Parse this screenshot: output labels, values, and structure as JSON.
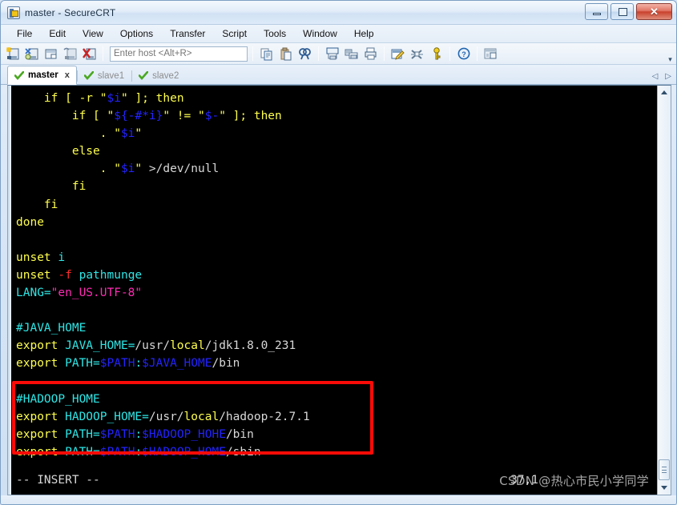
{
  "window": {
    "title": "master - SecureCRT",
    "app_icon": "securecrt-icon",
    "minimize_label": "",
    "maximize_label": "",
    "close_label": "✕"
  },
  "menubar": {
    "items": [
      {
        "label": "File"
      },
      {
        "label": "Edit"
      },
      {
        "label": "View"
      },
      {
        "label": "Options"
      },
      {
        "label": "Transfer"
      },
      {
        "label": "Script"
      },
      {
        "label": "Tools"
      },
      {
        "label": "Window"
      },
      {
        "label": "Help"
      }
    ]
  },
  "toolbar": {
    "host_placeholder": "Enter host <Alt+R>",
    "host_value": "",
    "overflow_label": "▾",
    "icons": [
      {
        "name": "new-session-icon"
      },
      {
        "name": "connect-sftp-icon"
      },
      {
        "name": "clone-session-icon"
      },
      {
        "name": "reconnect-icon"
      },
      {
        "name": "disconnect-icon"
      },
      {
        "name": "copy-icon"
      },
      {
        "name": "paste-icon"
      },
      {
        "name": "find-icon"
      },
      {
        "name": "print-screen-icon"
      },
      {
        "name": "log-session-icon"
      },
      {
        "name": "print-icon"
      },
      {
        "name": "session-options-icon"
      },
      {
        "name": "global-options-icon"
      },
      {
        "name": "key-icon"
      },
      {
        "name": "help-icon"
      },
      {
        "name": "arrange-windows-icon"
      }
    ]
  },
  "tabs": {
    "items": [
      {
        "label": "master",
        "active": true,
        "close_label": "x",
        "status_icon": "check-icon"
      },
      {
        "label": "slave1",
        "active": false,
        "close_label": "",
        "status_icon": "check-icon"
      },
      {
        "label": "slave2",
        "active": false,
        "close_label": "",
        "status_icon": "check-icon"
      }
    ],
    "nav_prev": "◁",
    "nav_next": "▷"
  },
  "terminal": {
    "lines": [
      [
        {
          "t": "    if [ ",
          "c": "kw"
        },
        {
          "t": "-r",
          "c": "kw"
        },
        {
          "t": " \"",
          "c": "kw"
        },
        {
          "t": "$i",
          "c": "var"
        },
        {
          "t": "\" ]; then",
          "c": "kw"
        }
      ],
      [
        {
          "t": "        if [ \"",
          "c": "kw"
        },
        {
          "t": "${-#*i}",
          "c": "var"
        },
        {
          "t": "\" != \"",
          "c": "kw"
        },
        {
          "t": "$-",
          "c": "var"
        },
        {
          "t": "\" ]; then",
          "c": "kw"
        }
      ],
      [
        {
          "t": "            . \"",
          "c": "kw"
        },
        {
          "t": "$i",
          "c": "var"
        },
        {
          "t": "\"",
          "c": "kw"
        }
      ],
      [
        {
          "t": "        else",
          "c": "kw"
        }
      ],
      [
        {
          "t": "            . \"",
          "c": "kw"
        },
        {
          "t": "$i",
          "c": "var"
        },
        {
          "t": "\" ",
          "c": "kw"
        },
        {
          "t": ">/dev/null",
          "c": "white"
        }
      ],
      [
        {
          "t": "        fi",
          "c": "kw"
        }
      ],
      [
        {
          "t": "    fi",
          "c": "kw"
        }
      ],
      [
        {
          "t": "done",
          "c": "kw"
        }
      ],
      [
        {
          "t": "",
          "c": "white"
        }
      ],
      [
        {
          "t": "unset",
          "c": "kw"
        },
        {
          "t": " i",
          "c": "cyan"
        }
      ],
      [
        {
          "t": "unset",
          "c": "kw"
        },
        {
          "t": " ",
          "c": "white"
        },
        {
          "t": "-f",
          "c": "red"
        },
        {
          "t": " pathmunge",
          "c": "cyan"
        }
      ],
      [
        {
          "t": "LANG=",
          "c": "cyan"
        },
        {
          "t": "\"en_US.UTF-8\"",
          "c": "str"
        }
      ],
      [
        {
          "t": "",
          "c": "white"
        }
      ],
      [
        {
          "t": "#JAVA_HOME",
          "c": "cyan"
        }
      ],
      [
        {
          "t": "export",
          "c": "kw"
        },
        {
          "t": " JAVA_HOME=",
          "c": "cyan"
        },
        {
          "t": "/usr/",
          "c": "white"
        },
        {
          "t": "local",
          "c": "dir"
        },
        {
          "t": "/jdk1.8.0_231",
          "c": "white"
        }
      ],
      [
        {
          "t": "export",
          "c": "kw"
        },
        {
          "t": " PATH=",
          "c": "cyan"
        },
        {
          "t": "$PATH",
          "c": "var"
        },
        {
          "t": ":",
          "c": "cyan"
        },
        {
          "t": "$JAVA_HOME",
          "c": "var"
        },
        {
          "t": "/bin",
          "c": "white"
        }
      ],
      [
        {
          "t": "",
          "c": "white"
        }
      ],
      [
        {
          "t": "#HADOOP_HOME",
          "c": "cyan"
        }
      ],
      [
        {
          "t": "export",
          "c": "kw"
        },
        {
          "t": " HADOOP_HOME=",
          "c": "cyan"
        },
        {
          "t": "/usr/",
          "c": "white"
        },
        {
          "t": "local",
          "c": "dir"
        },
        {
          "t": "/hadoop-2.7.1",
          "c": "white"
        }
      ],
      [
        {
          "t": "export",
          "c": "kw"
        },
        {
          "t": " PATH=",
          "c": "cyan"
        },
        {
          "t": "$PATH",
          "c": "var"
        },
        {
          "t": ":",
          "c": "cyan"
        },
        {
          "t": "$HADOOP_HOHE",
          "c": "var"
        },
        {
          "t": "/bin",
          "c": "white"
        }
      ],
      [
        {
          "t": "export",
          "c": "kw"
        },
        {
          "t": " PATH=",
          "c": "cyan"
        },
        {
          "t": "$PATH",
          "c": "var"
        },
        {
          "t": ":",
          "c": "cyan"
        },
        {
          "t": "$HADOOP_HOME",
          "c": "var"
        },
        {
          "t": "/sbin",
          "c": "white"
        }
      ]
    ],
    "status_mode": "-- INSERT --",
    "cursor_position": "37,1",
    "watermark": "CSDN @热心市民小学同学",
    "highlight_box_color": "#fb0b07"
  },
  "scrollbar": {
    "up_arrow": "▲",
    "down_arrow": "▼"
  }
}
